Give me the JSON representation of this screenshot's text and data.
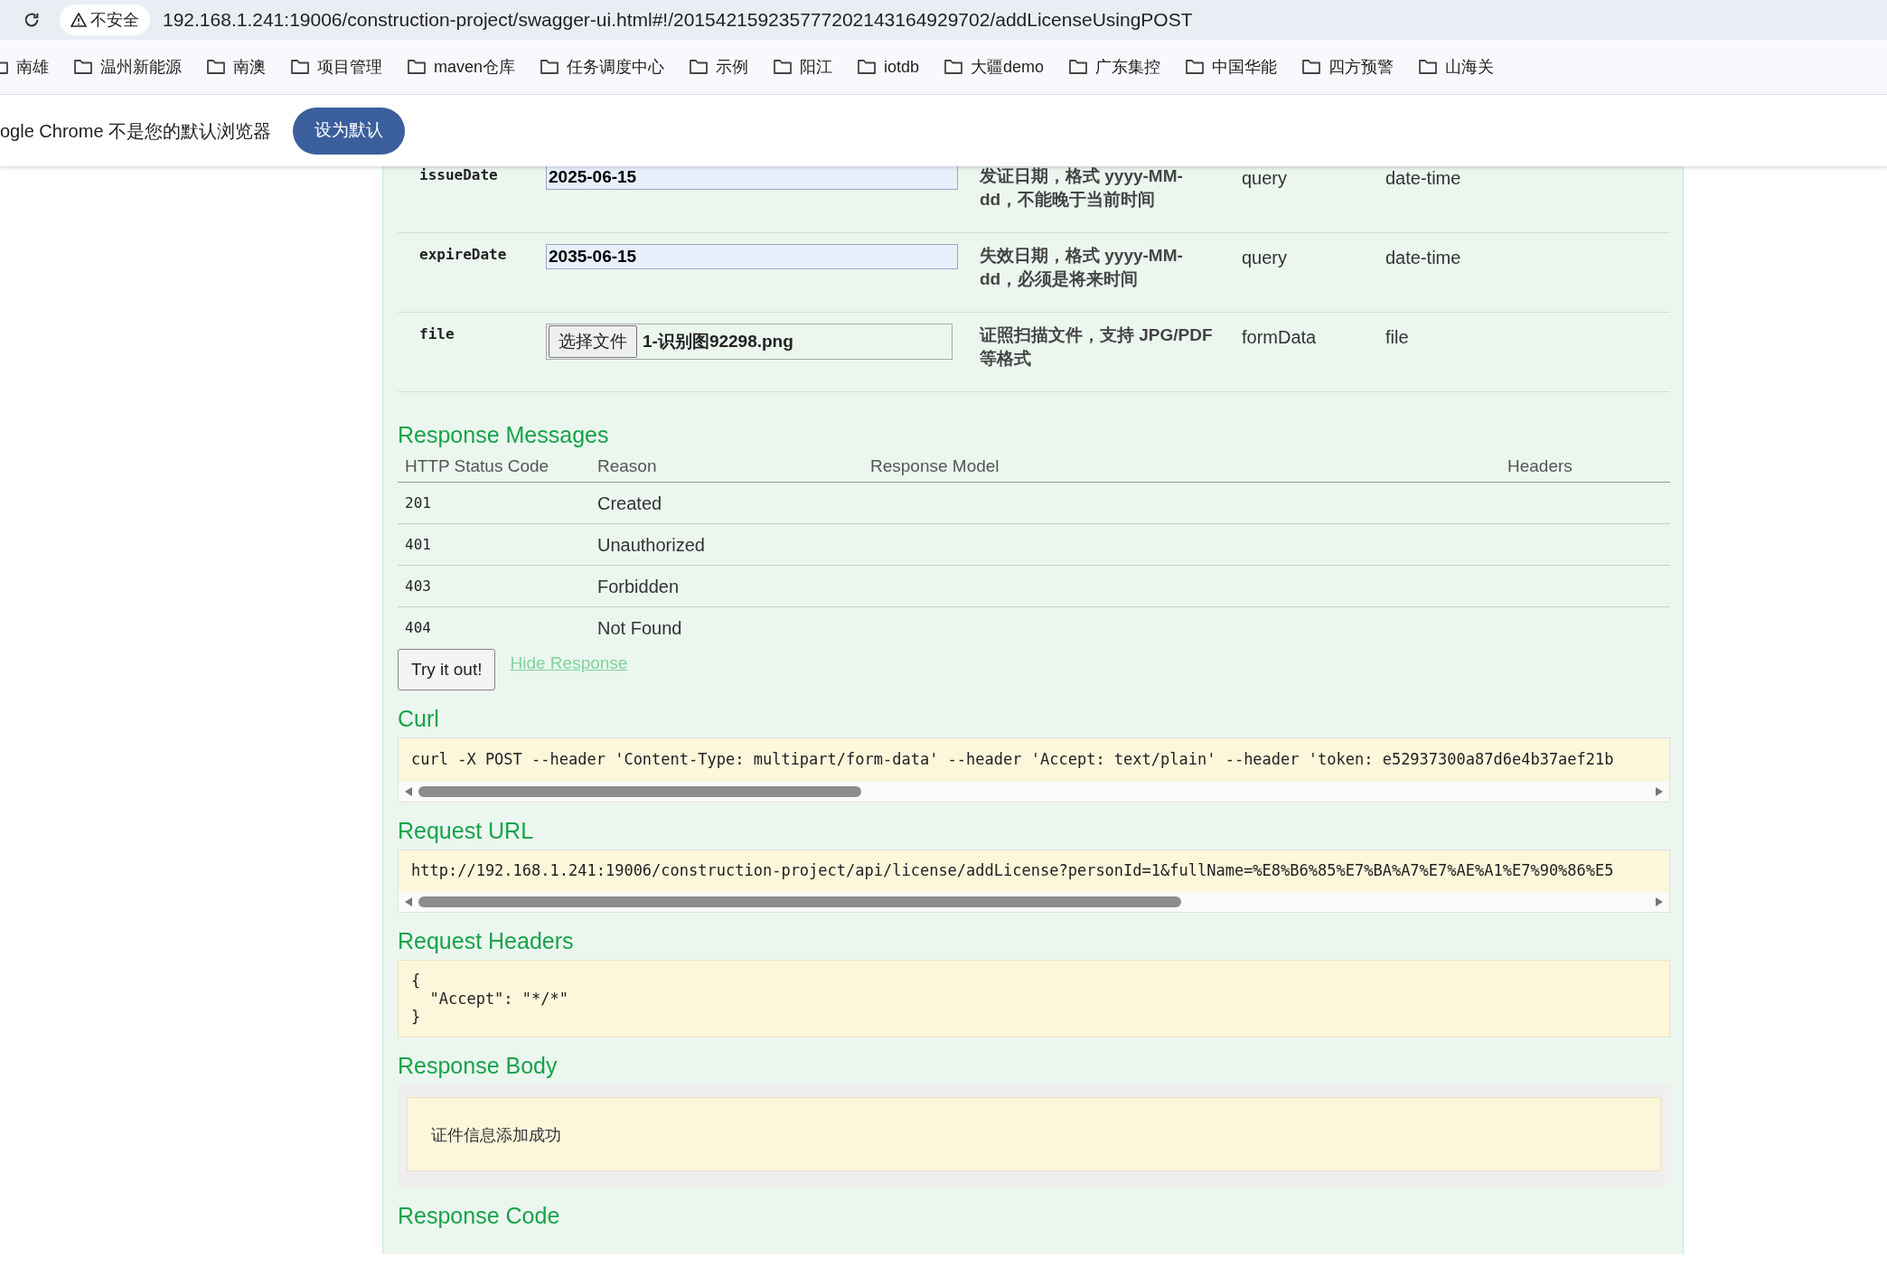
{
  "browser": {
    "security_label": "不安全",
    "url": "192.168.1.241:19006/construction-project/swagger-ui.html#!/201542159235777202143164929702/addLicenseUsingPOST",
    "bookmarks": [
      "南雄",
      "温州新能源",
      "南澳",
      "项目管理",
      "maven仓库",
      "任务调度中心",
      "示例",
      "阳江",
      "iotdb",
      "大疆demo",
      "广东集控",
      "中国华能",
      "四方预警",
      "山海关"
    ],
    "notice": {
      "text": "ogle Chrome 不是您的默认浏览器",
      "button": "设为默认"
    }
  },
  "params": [
    {
      "kind": "text",
      "name": "issueDate",
      "value": "2025-06-15",
      "description": "发证日期，格式 yyyy-MM-dd，不能晚于当前时间",
      "param_type": "query",
      "data_type": "date-time"
    },
    {
      "kind": "text",
      "name": "expireDate",
      "value": "2035-06-15",
      "description": "失效日期，格式 yyyy-MM-dd，必须是将来时间",
      "param_type": "query",
      "data_type": "date-time"
    },
    {
      "kind": "file",
      "name": "file",
      "button": "选择文件",
      "value": "1-识别图92298.png",
      "description": "证照扫描文件，支持 JPG/PDF 等格式",
      "param_type": "formData",
      "data_type": "file"
    }
  ],
  "response_messages": {
    "title": "Response Messages",
    "columns": [
      "HTTP Status Code",
      "Reason",
      "Response Model",
      "Headers"
    ],
    "rows": [
      {
        "code": "201",
        "reason": "Created"
      },
      {
        "code": "401",
        "reason": "Unauthorized"
      },
      {
        "code": "403",
        "reason": "Forbidden"
      },
      {
        "code": "404",
        "reason": "Not Found"
      }
    ]
  },
  "try_button": "Try it out!",
  "hide_link": "Hide Response",
  "curl": {
    "title": "Curl",
    "text": "curl -X POST --header 'Content-Type: multipart/form-data' --header 'Accept: text/plain' --header 'token: e52937300a87d6e4b37aef21b"
  },
  "request_url": {
    "title": "Request URL",
    "text": "http://192.168.1.241:19006/construction-project/api/license/addLicense?personId=1&fullName=%E8%B6%85%E7%BA%A7%E7%AE%A1%E7%90%86%E5"
  },
  "request_headers": {
    "title": "Request Headers",
    "lines": [
      "{",
      "  \"Accept\": \"*/*\"",
      "}"
    ]
  },
  "response_body": {
    "title": "Response Body",
    "text": "证件信息添加成功"
  },
  "response_code": {
    "title": "Response Code"
  }
}
